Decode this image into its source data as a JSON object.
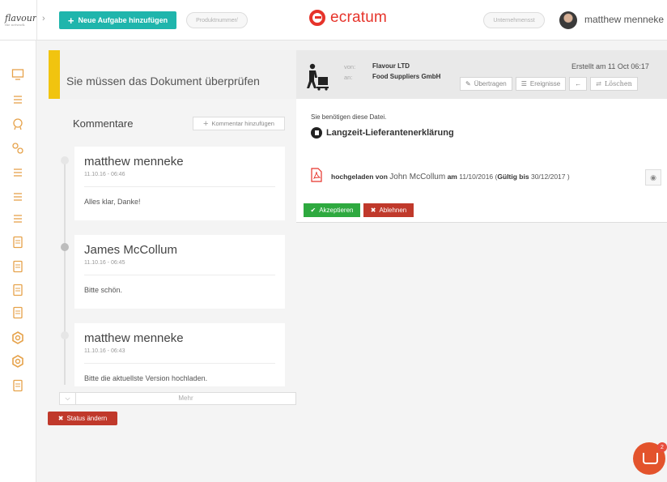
{
  "app": {
    "logo_text": "flavour",
    "logo_sub": "the network",
    "brand_name": "ecratum"
  },
  "header": {
    "add_task_label": "Neue Aufgabe hinzufügen",
    "product_placeholder": "Produktnummer/",
    "company_placeholder": "Unternehmensst",
    "user_name": "matthew menneke"
  },
  "sidebar": {
    "icons": [
      "monitor-icon",
      "supplier-search-icon",
      "certificate-icon",
      "partners-icon",
      "checklist-icon",
      "task-list-icon",
      "chat-transfer-icon",
      "document-list-icon",
      "document-check-icon",
      "document-stamp-icon",
      "document-box-icon",
      "hexagon-gear-icon",
      "hexagon-gear-alt-icon",
      "report-icon"
    ]
  },
  "review": {
    "banner_text": "Sie müssen das Dokument überprüfen"
  },
  "comments": {
    "title": "Kommentare",
    "add_label": "Kommentar hinzufügen",
    "items": [
      {
        "author": "matthew menneke",
        "time": "11.10.16 - 06:46",
        "text": "Alles klar, Danke!"
      },
      {
        "author": "James McCollum",
        "time": "11.10.16 - 06:45",
        "text": "Bitte schön."
      },
      {
        "author": "matthew menneke",
        "time": "11.10.16 - 06:43",
        "text": "Bitte die aktuellste Version hochladen."
      }
    ],
    "more_label": "Mehr"
  },
  "status_button": "Status ändern",
  "document": {
    "from_label": "von:",
    "to_label": "an:",
    "from": "Flavour LTD",
    "to": "Food Suppliers GmbH",
    "created": "Erstellt am 11 Oct 06:17",
    "actions": {
      "transfer": "Übertragen",
      "events": "Ereignisse",
      "delete": "Löschen"
    },
    "need_file_text": "Sie benötigen diese Datei.",
    "name": "Langzeit-Lieferantenerklärung",
    "upload": {
      "uploaded_by_label": "hochgeladen von",
      "uploader": "John McCollum",
      "on_label": "am",
      "date": "11/10/2016",
      "open_paren": "(",
      "valid_until_label": "Gültig bis",
      "valid_until": "30/12/2017",
      "close_paren": ")"
    },
    "accept_label": "Akzeptieren",
    "reject_label": "Ablehnen"
  },
  "chat": {
    "badge": "2"
  },
  "colors": {
    "teal": "#1fb5ac",
    "brand_red": "#e6332a",
    "warning_yellow": "#f1c40f",
    "danger": "#c0392b",
    "success": "#2ea93f",
    "sidebar_icon": "#e6a24a"
  }
}
